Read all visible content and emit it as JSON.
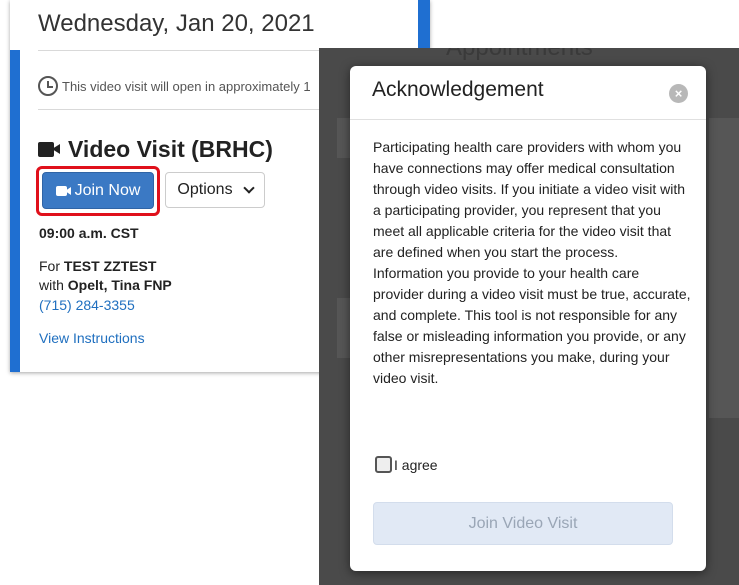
{
  "card": {
    "date": "Wednesday, Jan 20, 2021",
    "notice": "This video visit will open in approximately 1",
    "visit_title": "Video Visit (BRHC)",
    "join_now_label": "Join Now",
    "options_label": "Options",
    "time": "09:00 a.m. CST",
    "for_prefix": "For ",
    "patient": "TEST ZZTEST",
    "with_prefix": "with ",
    "provider": "Opelt, Tina FNP",
    "phone": "(715) 284-3355",
    "instructions_link": "View Instructions"
  },
  "background_page": {
    "title": "Appointments"
  },
  "modal": {
    "title": "Acknowledgement",
    "close_icon": "×",
    "body": "Participating health care providers with whom you have connections may offer medical consultation through video visits. If you initiate a video visit with a participating provider, you represent that you meet all applicable criteria for the video visit that are defined when you start the process. Information you provide to your health care provider during a video visit must be true, accurate, and complete. This tool is not responsible for any false or misleading information you provide, or any other misrepresentations you make, during your video visit.",
    "agree_label": "I agree",
    "agree_checked": false,
    "join_video_label": "Join Video Visit",
    "join_video_enabled": false
  },
  "colors": {
    "accent_blue": "#1f6fd1",
    "join_button": "#3b79c4",
    "highlight_red": "#e0101b",
    "link_blue": "#1f6fbf",
    "overlay": "#4a4a4a",
    "disabled_button": "#e1e9f5"
  }
}
